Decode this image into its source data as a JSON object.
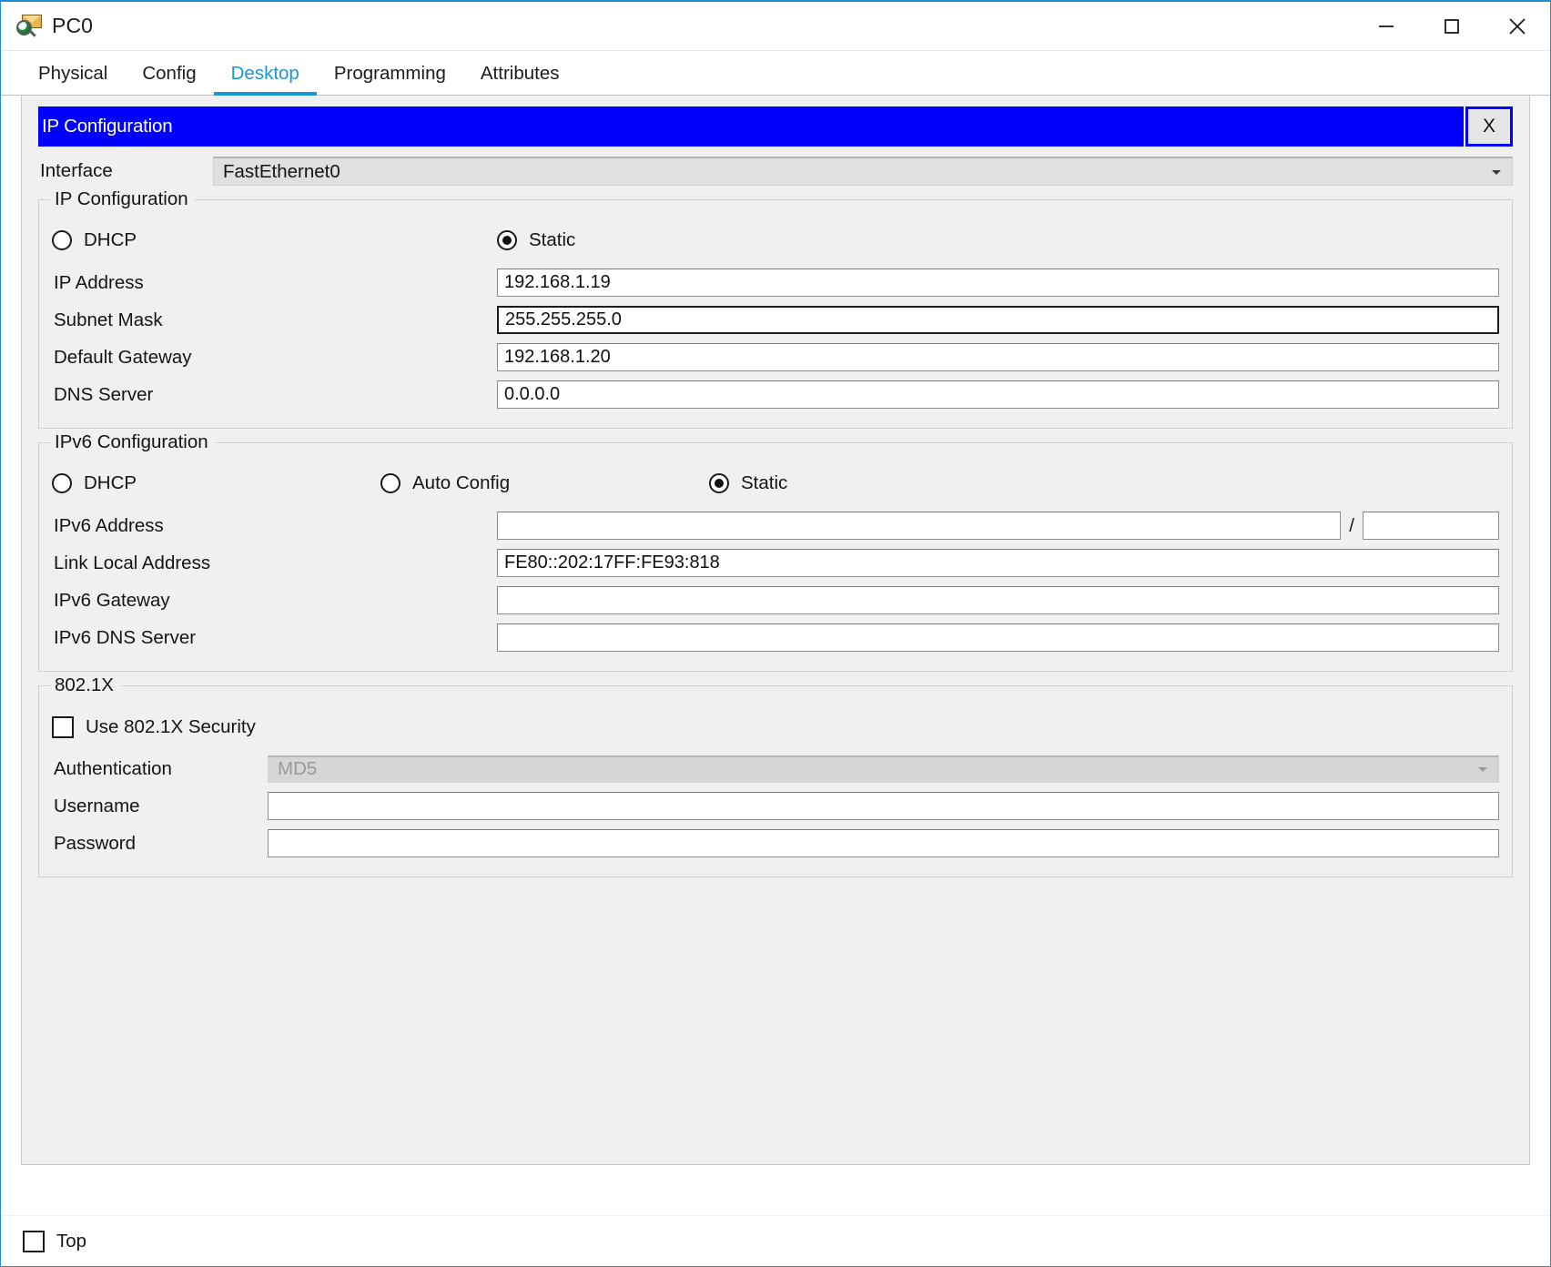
{
  "window": {
    "title": "PC0",
    "icon": "pc-envelope-magnifier-icon",
    "controls": {
      "minimize": "minimize-icon",
      "maximize": "maximize-icon",
      "close": "close-icon"
    }
  },
  "tabs": [
    {
      "label": "Physical",
      "active": false
    },
    {
      "label": "Config",
      "active": false
    },
    {
      "label": "Desktop",
      "active": true
    },
    {
      "label": "Programming",
      "active": false
    },
    {
      "label": "Attributes",
      "active": false
    }
  ],
  "dialog": {
    "title": "IP Configuration",
    "close_label": "X",
    "title_bg": "#0000ff",
    "title_fg": "#ffffff"
  },
  "interface": {
    "label": "Interface",
    "value": "FastEthernet0"
  },
  "ip_configuration": {
    "legend": "IP Configuration",
    "mode_options": [
      {
        "label": "DHCP",
        "selected": false
      },
      {
        "label": "Static",
        "selected": true
      }
    ],
    "fields": [
      {
        "label": "IP Address",
        "value": "192.168.1.19",
        "focused": false
      },
      {
        "label": "Subnet Mask",
        "value": "255.255.255.0",
        "focused": true
      },
      {
        "label": "Default Gateway",
        "value": "192.168.1.20",
        "focused": false
      },
      {
        "label": "DNS Server",
        "value": "0.0.0.0",
        "focused": false
      }
    ]
  },
  "ipv6_configuration": {
    "legend": "IPv6 Configuration",
    "mode_options": [
      {
        "label": "DHCP",
        "selected": false
      },
      {
        "label": "Auto Config",
        "selected": false
      },
      {
        "label": "Static",
        "selected": true
      }
    ],
    "address_label": "IPv6 Address",
    "address_value": "",
    "prefix_separator": "/",
    "prefix_value": "",
    "fields": [
      {
        "label": "Link Local Address",
        "value": "FE80::202:17FF:FE93:818"
      },
      {
        "label": "IPv6 Gateway",
        "value": ""
      },
      {
        "label": "IPv6 DNS Server",
        "value": ""
      }
    ]
  },
  "dot1x": {
    "legend": "802.1X",
    "use_security_label": "Use 802.1X Security",
    "use_security_checked": false,
    "authentication_label": "Authentication",
    "authentication_value": "MD5",
    "authentication_disabled": true,
    "username_label": "Username",
    "username_value": "",
    "password_label": "Password",
    "password_value": ""
  },
  "footer": {
    "top_label": "Top",
    "top_checked": false
  }
}
